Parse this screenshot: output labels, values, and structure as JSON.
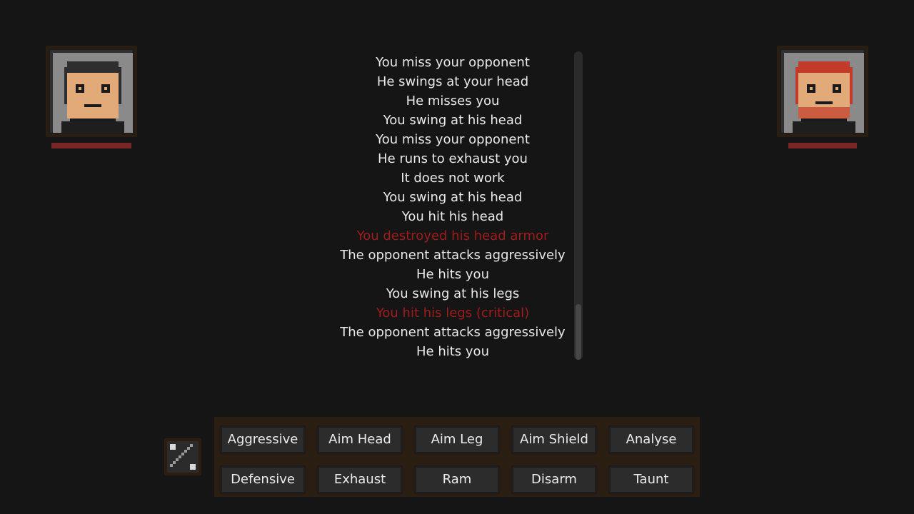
{
  "player": {
    "health_fraction": 1.0
  },
  "opponent": {
    "health_fraction": 0.86
  },
  "combat_log": {
    "lines": [
      {
        "text": "You miss your opponent",
        "highlight": false
      },
      {
        "text": "He swings at your head",
        "highlight": false
      },
      {
        "text": "He misses you",
        "highlight": false
      },
      {
        "text": "You swing at his head",
        "highlight": false
      },
      {
        "text": "You miss your opponent",
        "highlight": false
      },
      {
        "text": "He runs to exhaust you",
        "highlight": false
      },
      {
        "text": "It does not work",
        "highlight": false
      },
      {
        "text": "You swing at his head",
        "highlight": false
      },
      {
        "text": "You hit his head",
        "highlight": false
      },
      {
        "text": "You destroyed his head armor",
        "highlight": true
      },
      {
        "text": "The opponent attacks aggressively",
        "highlight": false
      },
      {
        "text": "He hits you",
        "highlight": false
      },
      {
        "text": "You swing at his legs",
        "highlight": false
      },
      {
        "text": "You hit his legs (critical)",
        "highlight": true
      },
      {
        "text": "The opponent attacks aggressively",
        "highlight": false
      },
      {
        "text": "He hits you",
        "highlight": false
      }
    ],
    "scroll_position": 1.0,
    "visible_fraction": 0.18
  },
  "actions": {
    "row1": [
      {
        "label": "Aggressive",
        "name": "aggressive"
      },
      {
        "label": "Aim Head",
        "name": "aim-head"
      },
      {
        "label": "Aim Leg",
        "name": "aim-leg"
      },
      {
        "label": "Aim Shield",
        "name": "aim-shield"
      },
      {
        "label": "Analyse",
        "name": "analyse"
      }
    ],
    "row2": [
      {
        "label": "Defensive",
        "name": "defensive"
      },
      {
        "label": "Exhaust",
        "name": "exhaust"
      },
      {
        "label": "Ram",
        "name": "ram"
      },
      {
        "label": "Disarm",
        "name": "disarm"
      },
      {
        "label": "Taunt",
        "name": "taunt"
      }
    ]
  },
  "stance_icon": "crossed-weapon-icon",
  "colors": {
    "log_text": "#e9e9e9",
    "log_alert": "#a01c1c",
    "health": "#7a2626",
    "panel": "#2a1d12"
  }
}
